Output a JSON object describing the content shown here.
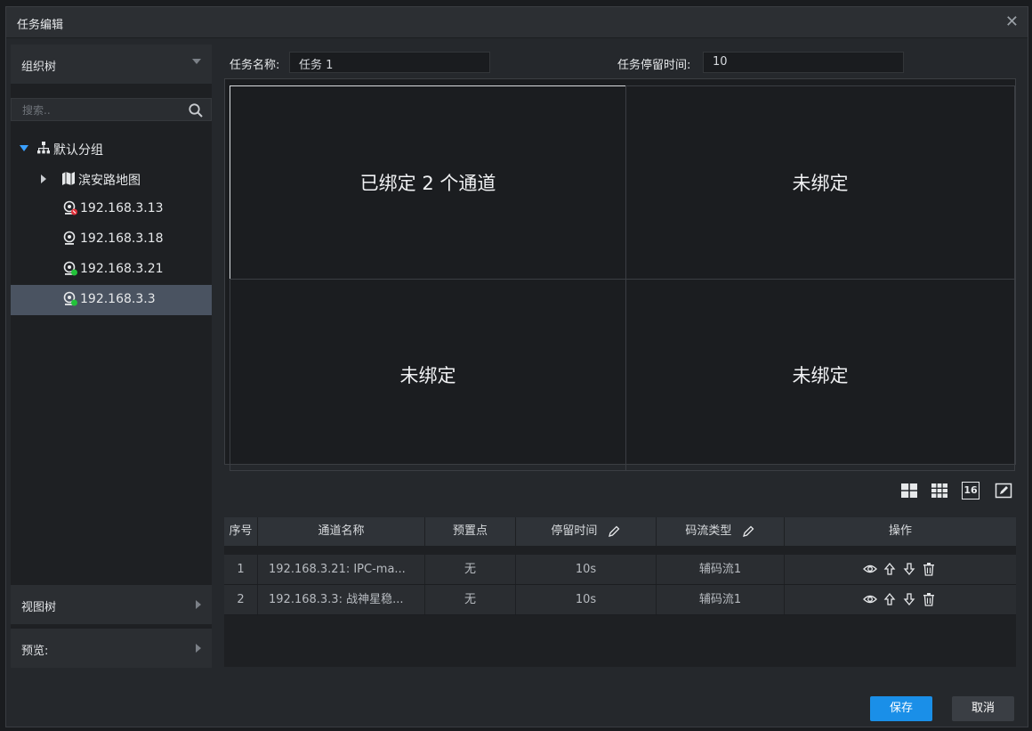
{
  "window": {
    "title": "任务编辑"
  },
  "left": {
    "group_tree_label": "组织树",
    "view_tree_label": "视图树",
    "preview_label": "预览:",
    "search_placeholder": "搜索..",
    "tree": {
      "root": "默认分组",
      "map": "滨安路地图",
      "devices": [
        "192.168.3.13",
        "192.168.3.18",
        "192.168.3.21",
        "192.168.3.3"
      ],
      "selected_index": 3
    }
  },
  "task": {
    "name_label": "任务名称:",
    "name_value": "任务 1",
    "dwell_label": "任务停留时间:",
    "dwell_value": "10"
  },
  "grid": {
    "cells": [
      "已绑定 2 个通道",
      "未绑定",
      "未绑定",
      "未绑定"
    ]
  },
  "layout_buttons": {
    "sixteen_label": "16"
  },
  "table": {
    "headers": [
      "序号",
      "通道名称",
      "预置点",
      "停留时间",
      "码流类型",
      "操作"
    ],
    "rows": [
      {
        "index": "1",
        "name": "192.168.3.21: IPC-ma...",
        "preset": "无",
        "dwell": "10s",
        "stream": "辅码流1"
      },
      {
        "index": "2",
        "name": "192.168.3.3: 战神星稳...",
        "preset": "无",
        "dwell": "10s",
        "stream": "辅码流1"
      }
    ]
  },
  "footer": {
    "save_label": "保存",
    "cancel_label": "取消"
  },
  "colors": {
    "accent": "#1a8fe8",
    "online": "#22c23a",
    "offline": "#e0303a",
    "tree_expander": "#3aa0ff"
  }
}
